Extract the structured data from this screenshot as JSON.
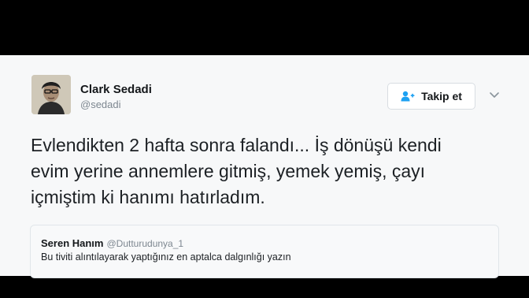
{
  "tweet": {
    "author": {
      "display_name": "Clark Sedadi",
      "handle": "@sedadi",
      "avatar_icon": "user-photo-icon"
    },
    "follow_button": {
      "label": "Takip et",
      "icon": "add-user-icon",
      "accent_color": "#1da1f2"
    },
    "menu_icon": "chevron-down-icon",
    "text": "Evlendikten 2 hafta sonra falandı... İş dönüşü kendi evim yerine annemlere gitmiş, yemek yemiş, çayı içmiştim ki hanımı hatırladım.",
    "quoted_tweet": {
      "display_name": "Seren Hanım",
      "handle": "@Dutturudunya_1",
      "text": "Bu tiviti alıntılayarak yaptığınız en aptalca dalgınlığı yazın"
    }
  }
}
